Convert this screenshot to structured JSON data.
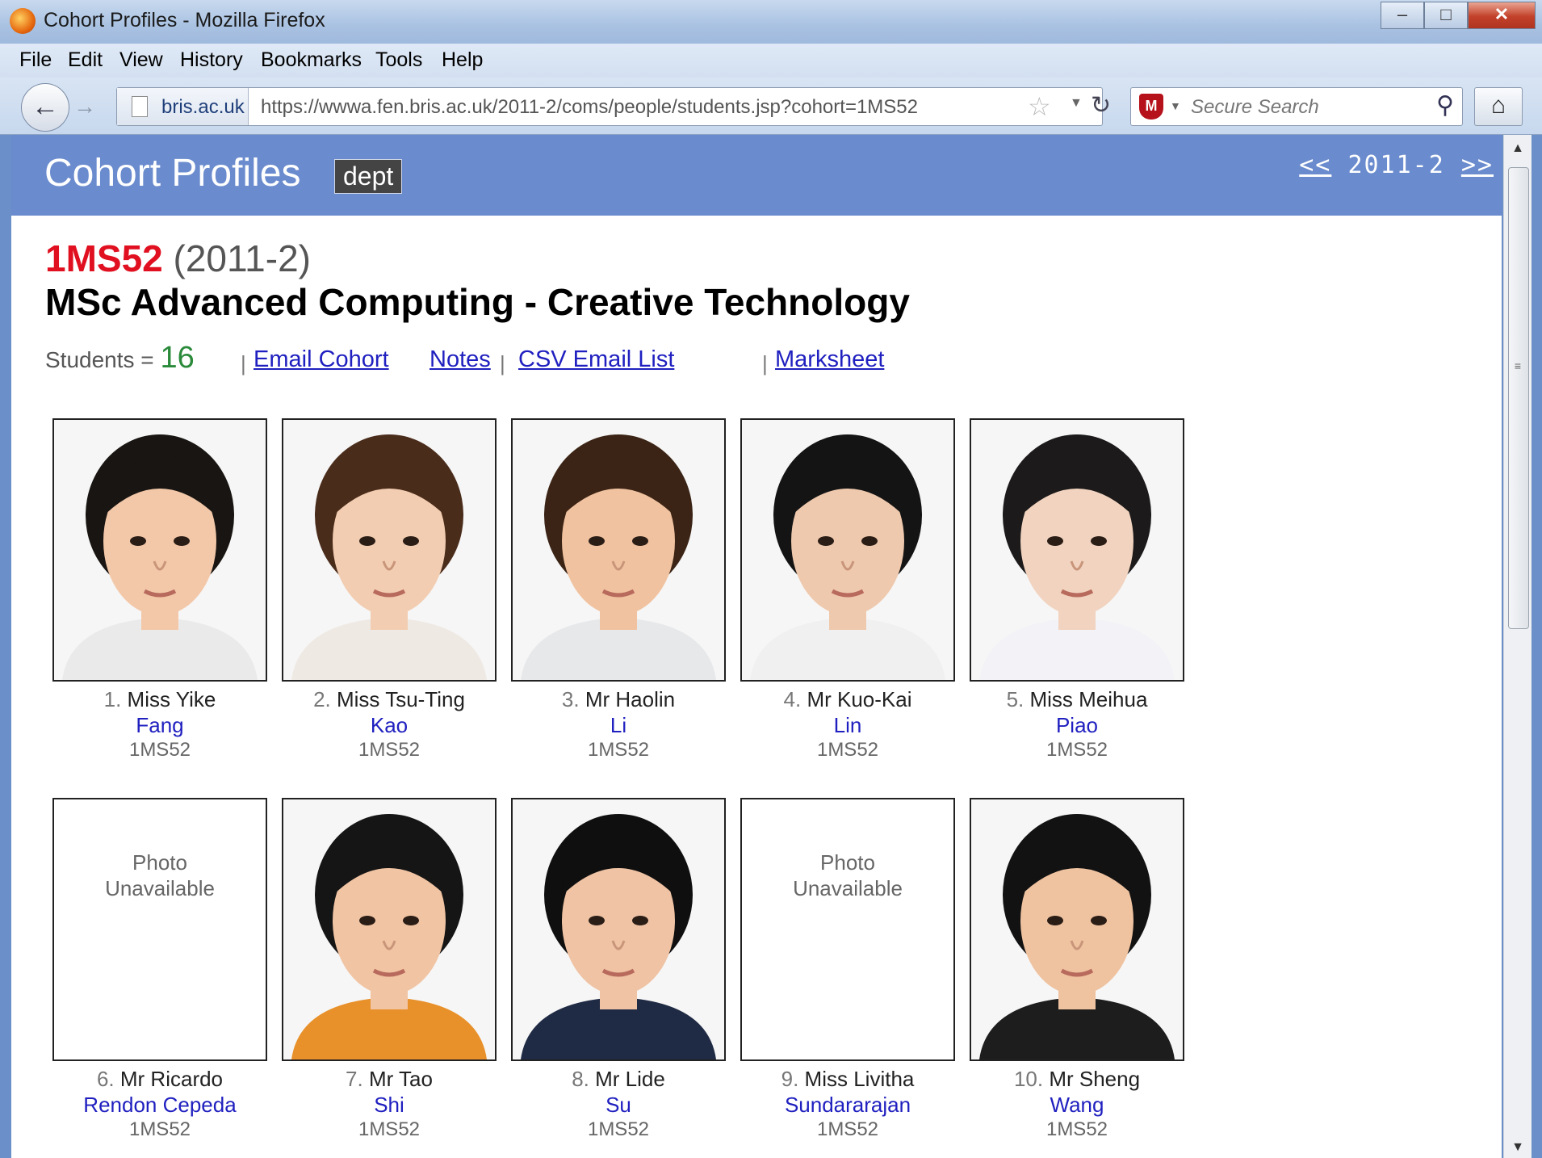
{
  "window": {
    "title": "Cohort Profiles - Mozilla Firefox"
  },
  "menu": [
    "File",
    "Edit",
    "View",
    "History",
    "Bookmarks",
    "Tools",
    "Help"
  ],
  "nav": {
    "site": "bris.ac.uk",
    "url": "https://wwwa.fen.bris.ac.uk/2011-2/coms/people/students.jsp?cohort=1MS52",
    "search_placeholder": "Secure Search"
  },
  "banner": {
    "title": "Cohort Profiles",
    "dept": "dept",
    "prev": "<<",
    "year": "2011-2",
    "next": ">>"
  },
  "cohort": {
    "code": "1MS52",
    "year": "(2011-2)",
    "programme": "MSc Advanced Computing - Creative Technology",
    "students_label": "Students =",
    "students_count": "16",
    "pipe": "|",
    "links": {
      "email": "Email Cohort",
      "notes": "Notes",
      "csv": "CSV Email List",
      "marksheet": "Marksheet"
    }
  },
  "photo_unavailable": [
    "Photo",
    "Unavailable"
  ],
  "students": [
    {
      "num": "1.",
      "name": "Miss Yike",
      "surname": "Fang",
      "code": "1MS52",
      "photo": true,
      "hair": "#181512",
      "skin": "#f3c8a9",
      "shirt": "#eaeaea"
    },
    {
      "num": "2.",
      "name": "Miss Tsu-Ting",
      "surname": "Kao",
      "code": "1MS52",
      "photo": true,
      "hair": "#4a2c1b",
      "skin": "#f2cdb1",
      "shirt": "#efe9e4"
    },
    {
      "num": "3.",
      "name": "Mr Haolin",
      "surname": "Li",
      "code": "1MS52",
      "photo": true,
      "hair": "#3b2415",
      "skin": "#f0c2a0",
      "shirt": "#e6e8ea"
    },
    {
      "num": "4.",
      "name": "Mr Kuo-Kai",
      "surname": "Lin",
      "code": "1MS52",
      "photo": true,
      "hair": "#141414",
      "skin": "#efc9ad",
      "shirt": "#f0f0f0"
    },
    {
      "num": "5.",
      "name": "Miss Meihua",
      "surname": "Piao",
      "code": "1MS52",
      "photo": true,
      "hair": "#1c1a1a",
      "skin": "#f1d3bf",
      "shirt": "#f3f3f7"
    },
    {
      "num": "6.",
      "name": "Mr Ricardo",
      "surname": "Rendon Cepeda",
      "code": "1MS52",
      "photo": false
    },
    {
      "num": "7.",
      "name": "Mr Tao",
      "surname": "Shi",
      "code": "1MS52",
      "photo": true,
      "hair": "#151515",
      "skin": "#f1c4a3",
      "shirt": "#e8902a"
    },
    {
      "num": "8.",
      "name": "Mr Lide",
      "surname": "Su",
      "code": "1MS52",
      "photo": true,
      "hair": "#0f0f0f",
      "skin": "#efc3a4",
      "shirt": "#1f2a44"
    },
    {
      "num": "9.",
      "name": "Miss Livitha",
      "surname": "Sundararajan",
      "code": "1MS52",
      "photo": false
    },
    {
      "num": "10.",
      "name": "Mr Sheng",
      "surname": "Wang",
      "code": "1MS52",
      "photo": true,
      "hair": "#121212",
      "skin": "#efc2a0",
      "shirt": "#1d1d1d"
    }
  ]
}
